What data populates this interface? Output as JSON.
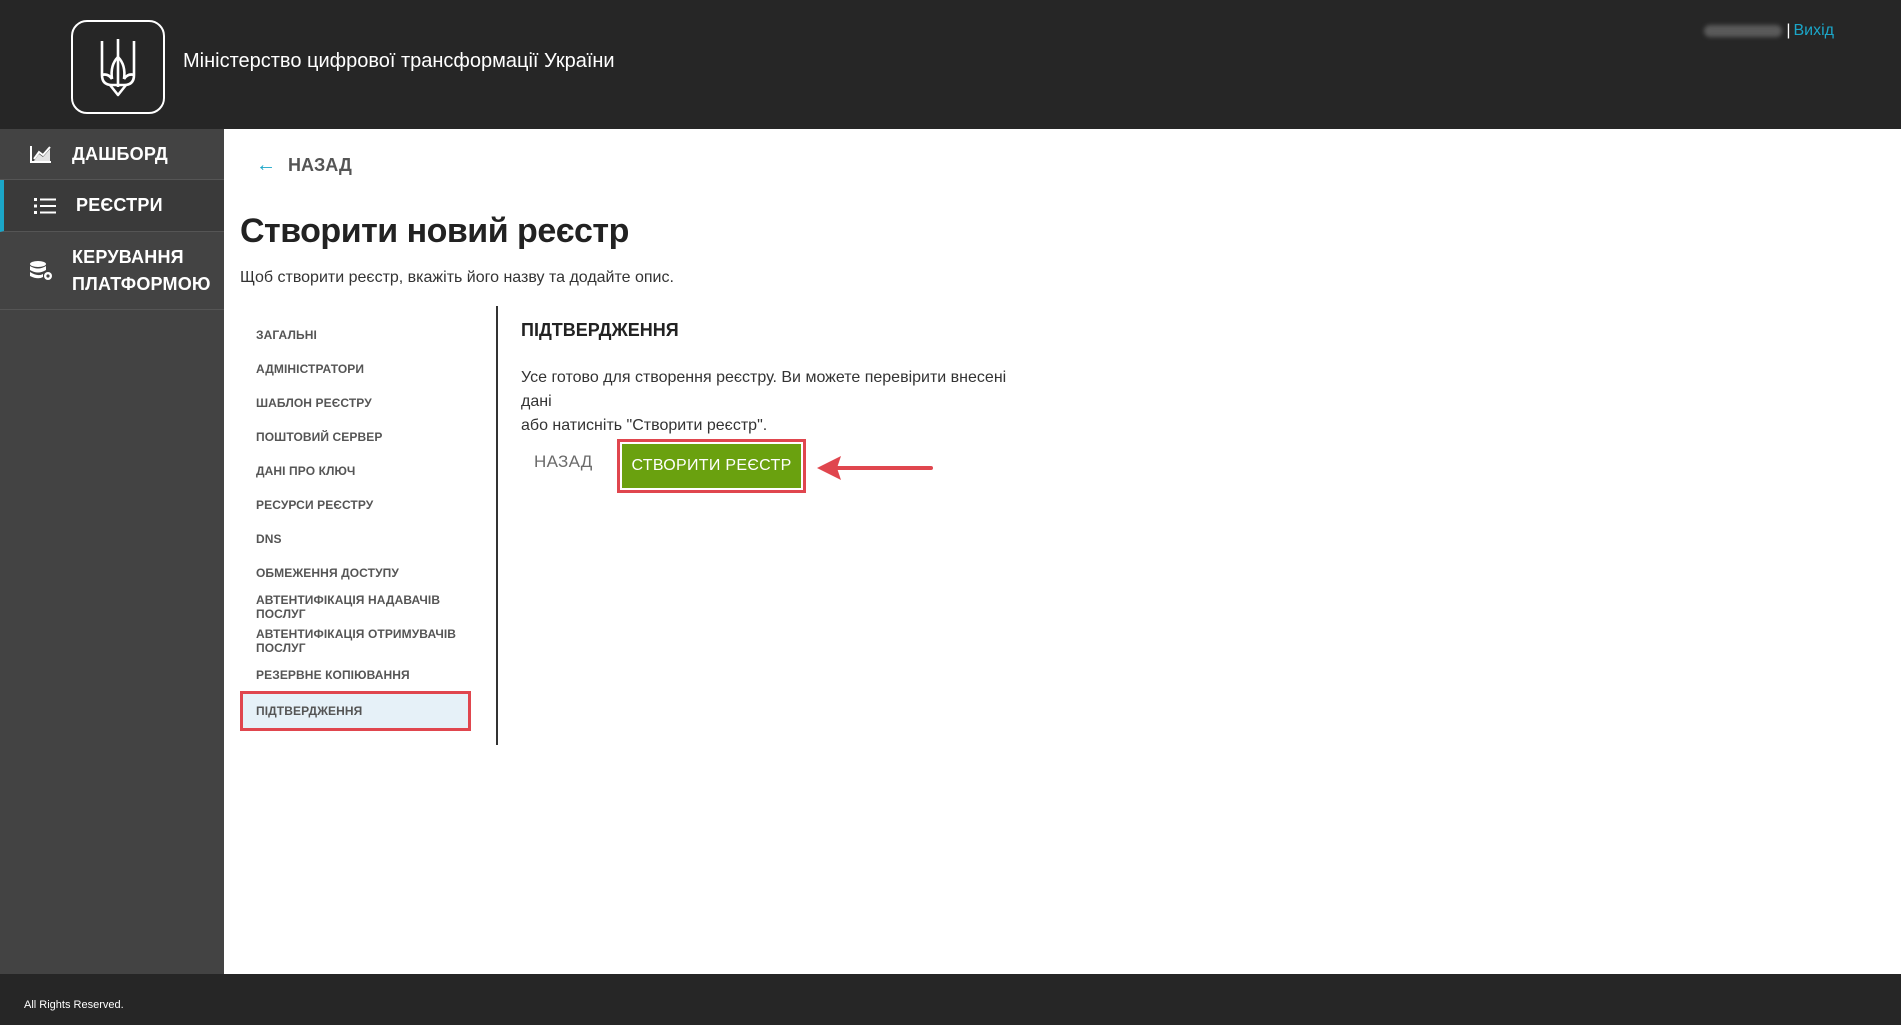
{
  "header": {
    "ministry_name": "Міністерство цифрової трансформації України",
    "separator": "|",
    "logout_label": "Вихід"
  },
  "sidebar": {
    "items": [
      {
        "label": "ДАШБОРД",
        "icon": "chart-line-icon"
      },
      {
        "label": "РЕЄСТРИ",
        "icon": "list-icon"
      },
      {
        "label_line1": "КЕРУВАННЯ",
        "label_line2": "ПЛАТФОРМОЮ",
        "icon": "database-gear-icon"
      }
    ]
  },
  "main": {
    "back_label": "НАЗАД",
    "title": "Створити новий реєстр",
    "subtitle": "Щоб створити реєстр, вкажіть його назву та додайте опис.",
    "steps": [
      "ЗАГАЛЬНІ",
      "АДМІНІСТРАТОРИ",
      "ШАБЛОН РЕЄСТРУ",
      "ПОШТОВИЙ СЕРВЕР",
      "ДАНІ ПРО КЛЮЧ",
      "РЕСУРСИ РЕЄСТРУ",
      "DNS",
      "ОБМЕЖЕННЯ ДОСТУПУ",
      "АВТЕНТИФІКАЦІЯ НАДАВАЧІВ ПОСЛУГ",
      "АВТЕНТИФІКАЦІЯ ОТРИМУВАЧІВ ПОСЛУГ",
      "РЕЗЕРВНЕ КОПІЮВАННЯ",
      "ПІДТВЕРДЖЕННЯ"
    ],
    "active_step": "ПІДТВЕРДЖЕННЯ",
    "section_title": "ПІДТВЕРДЖЕННЯ",
    "section_text_line1": "Усе готово для створення реєстру. Ви можете перевірити внесені дані",
    "section_text_line2": "або натисніть \"Створити реєстр\".",
    "btn_back": "НАЗАД",
    "btn_create": "СТВОРИТИ РЕЄСТР"
  },
  "footer": {
    "text": "All Rights Reserved."
  },
  "colors": {
    "header_bg": "#262626",
    "sidebar_bg": "#434343",
    "accent": "#1ba6c8",
    "create_button": "#6aa10f",
    "highlight_red": "#e0464e"
  }
}
